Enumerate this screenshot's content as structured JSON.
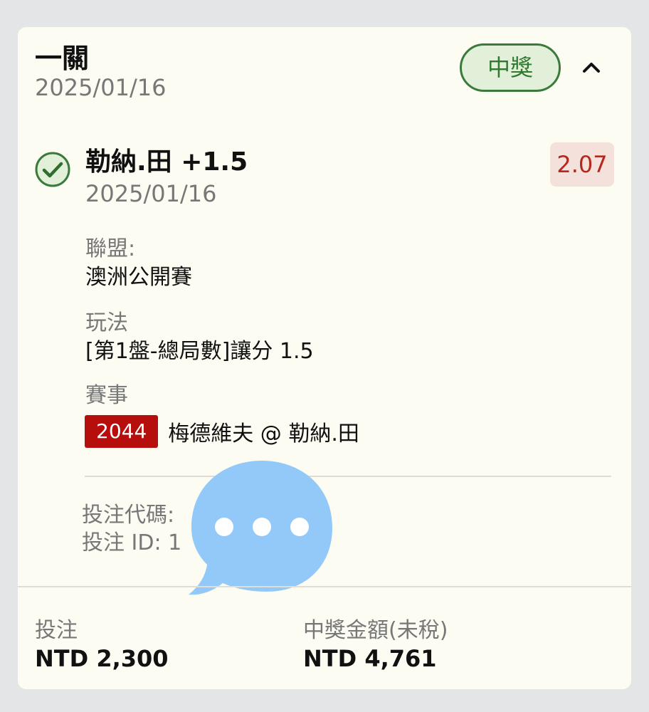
{
  "header": {
    "bet_type": "一關",
    "date": "2025/01/16",
    "status": "中獎",
    "collapse_icon": "chevron-up-icon"
  },
  "selection": {
    "status_icon": "check-circle-icon",
    "title": "勒納.田 +1.5",
    "date": "2025/01/16",
    "odds": "2.07",
    "league_label": "聯盟:",
    "league_value": "澳洲公開賽",
    "market_label": "玩法",
    "market_value": "[第1盤-總局數]讓分 1.5",
    "event_label": "賽事",
    "event_code": "2044",
    "event_name": "梅德維夫 @ 勒納.田"
  },
  "meta": {
    "bet_code_label": "投注代碼:",
    "bet_id_label": "投注 ID: 1",
    "overlay_icon": "chat-bubble-icon"
  },
  "summary": {
    "stake_label": "投注",
    "stake_value": "NTD 2,300",
    "payout_label": "中獎金額(未稅)",
    "payout_value": "NTD 4,761"
  },
  "colors": {
    "card_background": "#fdfcf2",
    "page_background": "#e4e5e7",
    "win_green": "#2f7a2f",
    "odds_red": "#b5281e",
    "event_code_red": "#b60d0d",
    "chat_bubble_blue": "#93c9f8"
  }
}
